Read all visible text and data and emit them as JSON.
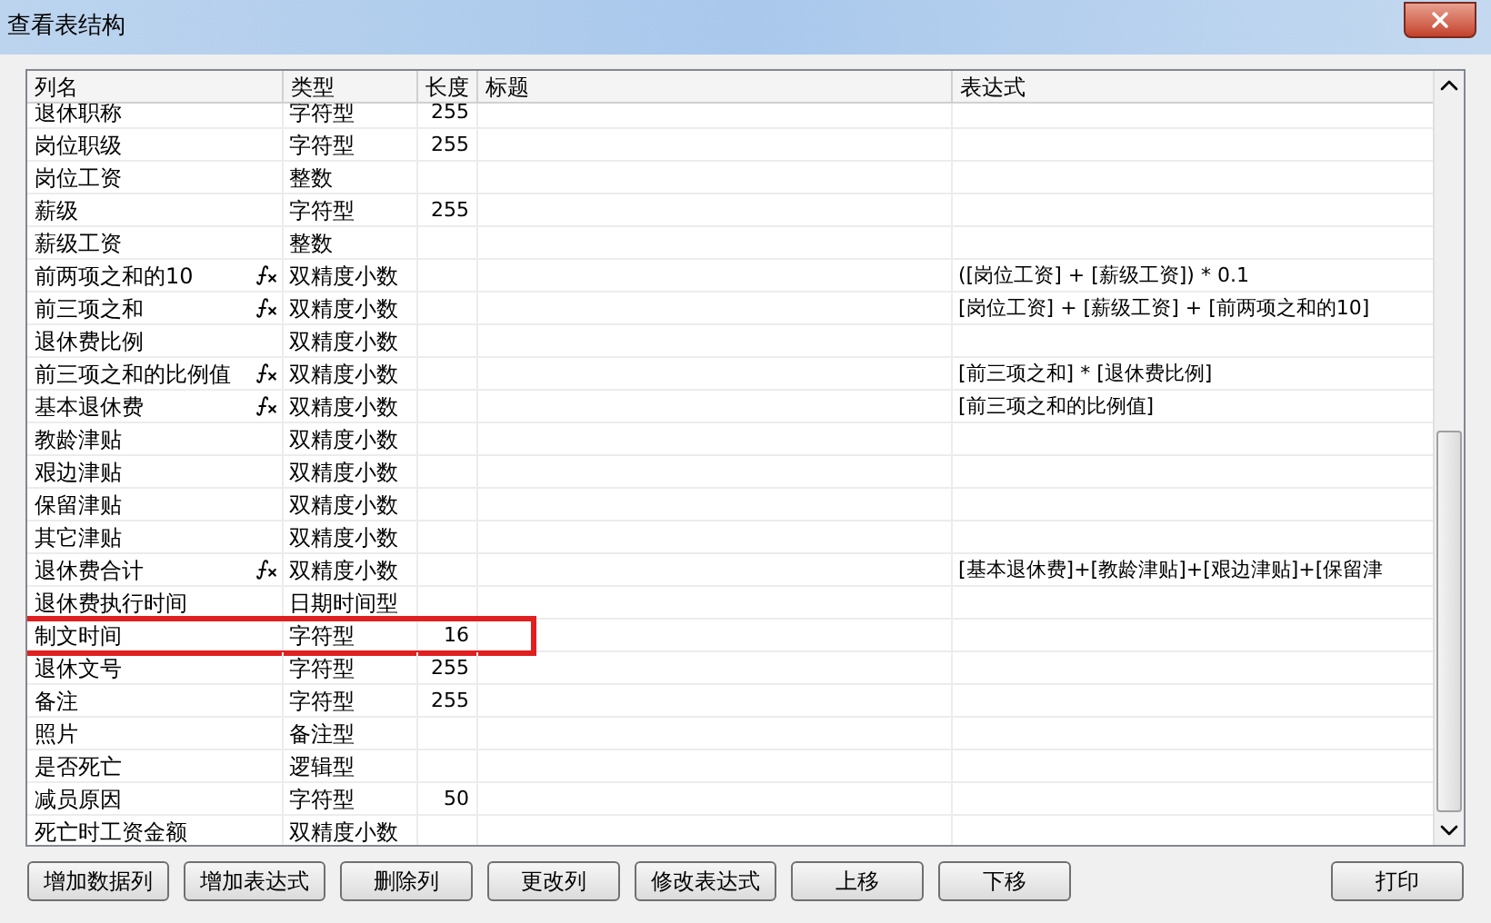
{
  "window": {
    "title": "查看表结构"
  },
  "table": {
    "columns": [
      "列名",
      "类型",
      "长度",
      "标题",
      "表达式"
    ],
    "rows": [
      {
        "name": "退休职称",
        "type": "字符型",
        "length": "255",
        "formula": false,
        "highlighted": false
      },
      {
        "name": "岗位职级",
        "type": "字符型",
        "length": "255",
        "formula": false,
        "highlighted": false
      },
      {
        "name": "岗位工资",
        "type": "整数",
        "formula": false,
        "highlighted": false
      },
      {
        "name": "薪级",
        "type": "字符型",
        "length": "255",
        "formula": false,
        "highlighted": false
      },
      {
        "name": "薪级工资",
        "type": "整数",
        "formula": false,
        "highlighted": false
      },
      {
        "name": "前两项之和的10",
        "type": "双精度小数",
        "formula": true,
        "expression": "([岗位工资] + [薪级工资]) * 0.1",
        "highlighted": false
      },
      {
        "name": "前三项之和",
        "type": "双精度小数",
        "formula": true,
        "expression": "[岗位工资] + [薪级工资] + [前两项之和的10]",
        "highlighted": false
      },
      {
        "name": "退休费比例",
        "type": "双精度小数",
        "formula": false,
        "highlighted": false
      },
      {
        "name": "前三项之和的比例值",
        "type": "双精度小数",
        "formula": true,
        "expression": "[前三项之和] * [退休费比例]",
        "highlighted": false
      },
      {
        "name": "基本退休费",
        "type": "双精度小数",
        "formula": true,
        "expression": "[前三项之和的比例值]",
        "highlighted": false
      },
      {
        "name": "教龄津贴",
        "type": "双精度小数",
        "formula": false,
        "highlighted": false
      },
      {
        "name": "艰边津贴",
        "type": "双精度小数",
        "formula": false,
        "highlighted": false
      },
      {
        "name": "保留津贴",
        "type": "双精度小数",
        "formula": false,
        "highlighted": false
      },
      {
        "name": "其它津贴",
        "type": "双精度小数",
        "formula": false,
        "highlighted": false
      },
      {
        "name": "退休费合计",
        "type": "双精度小数",
        "formula": true,
        "expression": "[基本退休费]+[教龄津贴]+[艰边津贴]+[保留津",
        "highlighted": false
      },
      {
        "name": "退休费执行时间",
        "type": "日期时间型",
        "formula": false,
        "highlighted": false
      },
      {
        "name": "制文时间",
        "type": "字符型",
        "length": "16",
        "formula": false,
        "highlighted": true
      },
      {
        "name": "退休文号",
        "type": "字符型",
        "length": "255",
        "formula": false,
        "highlighted": false
      },
      {
        "name": "备注",
        "type": "字符型",
        "length": "255",
        "formula": false,
        "highlighted": false
      },
      {
        "name": "照片",
        "type": "备注型",
        "formula": false,
        "highlighted": false
      },
      {
        "name": "是否死亡",
        "type": "逻辑型",
        "formula": false,
        "highlighted": false
      },
      {
        "name": "减员原因",
        "type": "字符型",
        "length": "50",
        "formula": false,
        "highlighted": false
      },
      {
        "name": "死亡时工资金额",
        "type": "双精度小数",
        "formula": false,
        "highlighted": false
      }
    ]
  },
  "buttons": [
    "增加数据列",
    "增加表达式",
    "删除列",
    "更改列",
    "修改表达式",
    "上移",
    "下移"
  ],
  "print_button": "打印"
}
